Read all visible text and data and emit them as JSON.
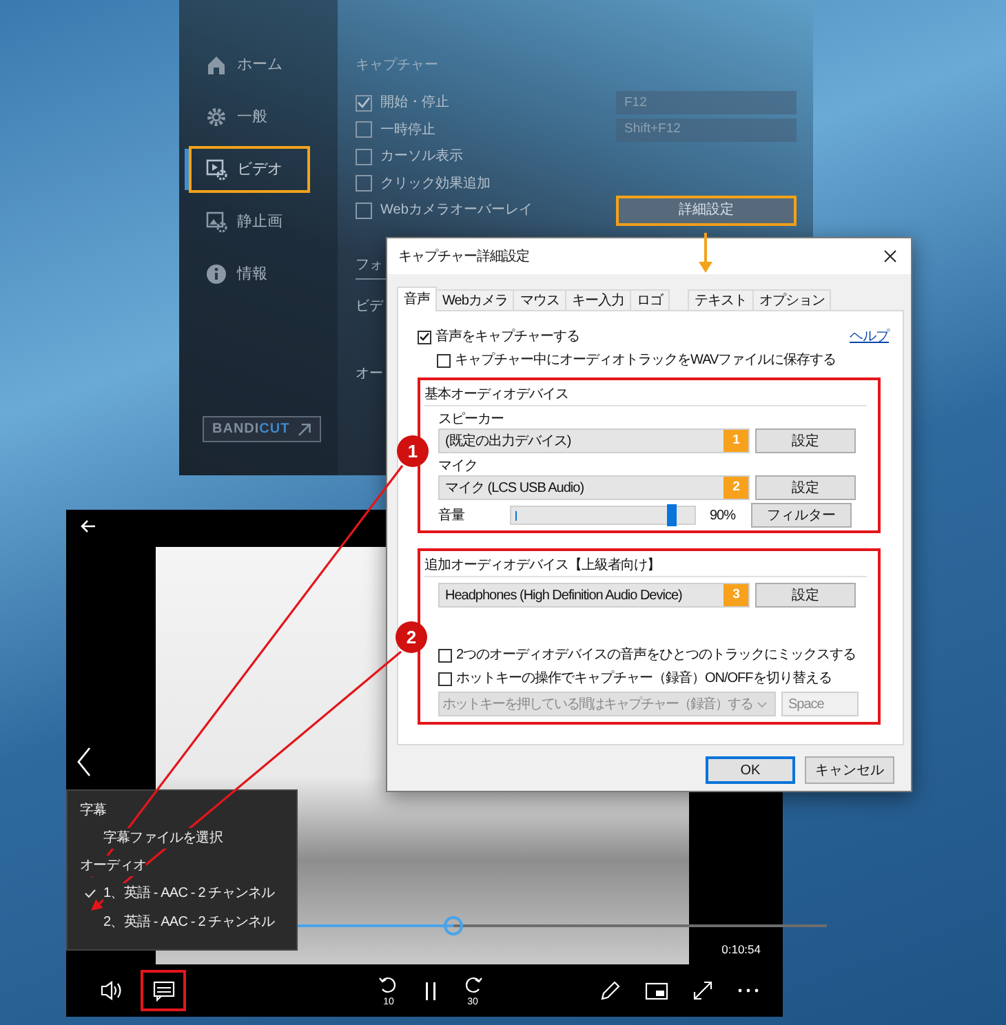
{
  "bandicam_window": {
    "sidebar": [
      {
        "label": "ホーム",
        "selected": false
      },
      {
        "label": "一般",
        "selected": false
      },
      {
        "label": "ビデオ",
        "selected": true
      },
      {
        "label": "静止画",
        "selected": false
      },
      {
        "label": "情報",
        "selected": false
      }
    ],
    "bandicut_button": {
      "parts": [
        "BANDI",
        "CUT"
      ]
    },
    "section_title": "キャプチャー",
    "options": [
      {
        "label": "開始・停止",
        "checked": true,
        "hotkey": "F12"
      },
      {
        "label": "一時停止",
        "checked": false,
        "hotkey": "Shift+F12"
      },
      {
        "label": "カーソル表示",
        "checked": false
      },
      {
        "label": "クリック効果追加",
        "checked": false
      },
      {
        "label": "Webカメラオーバーレイ",
        "checked": false
      }
    ],
    "advanced_button": "詳細設定",
    "format_heading": "フォ",
    "cut_labels": [
      "ビデ",
      "オー"
    ]
  },
  "dialog": {
    "title": "キャプチャー詳細設定",
    "tabs": [
      {
        "label": "音声",
        "selected": true
      },
      {
        "label": "Webカメラ",
        "selected": false
      },
      {
        "label": "マウス",
        "selected": false
      },
      {
        "label": "キー入力",
        "selected": false
      },
      {
        "label": "ロゴ",
        "selected": false
      },
      {
        "label": "テキスト",
        "selected": false
      },
      {
        "label": "オプション",
        "selected": false
      }
    ],
    "capture_audio": {
      "label": "音声をキャプチャーする",
      "checked": true
    },
    "help_link": "ヘルプ",
    "save_wav": {
      "label": "キャプチャー中にオーディオトラックをWAVファイルに保存する",
      "checked": false
    },
    "basic_group": {
      "title": "基本オーディオデバイス",
      "devices": [
        {
          "label": "スピーカー",
          "value": "(既定の出力デバイス)",
          "badge": "1",
          "button": "設定"
        },
        {
          "label": "マイク",
          "value": "マイク (LCS USB Audio)",
          "badge": "2",
          "button": "設定"
        }
      ],
      "volume": {
        "label": "音量",
        "level": 0.9,
        "reading": "90%",
        "button": "フィルター"
      }
    },
    "extra_group": {
      "title": "追加オーディオデバイス【上級者向け】",
      "device": {
        "value": "Headphones (High Definition Audio Device)",
        "badge": "3",
        "button": "設定"
      },
      "options": [
        {
          "label": "2つのオーディオデバイスの音声をひとつのトラックにミックスする",
          "checked": false
        },
        {
          "label": "ホットキーの操作でキャプチャー（録音）ON/OFFを切り替える",
          "checked": false
        }
      ],
      "hotkey_mode": {
        "value": "ホットキーを押している間はキャプチャー（録音）する",
        "disabled": true
      },
      "hotkey_key": {
        "value": "Space",
        "disabled": true
      }
    },
    "buttons": [
      {
        "label": "OK",
        "default": true
      },
      {
        "label": "キャンセル",
        "default": false
      }
    ]
  },
  "annotations": [
    {
      "number": "1"
    },
    {
      "number": "2"
    }
  ],
  "player": {
    "menu": {
      "sections": [
        {
          "title": "字幕",
          "items": [
            {
              "label": "字幕ファイルを選択",
              "selected": false
            }
          ]
        },
        {
          "title": "オーディオ",
          "items": [
            {
              "label": "1、英語 - AAC - 2 チャンネル",
              "selected": true
            },
            {
              "label": "2、英語 - AAC - 2 チャンネル",
              "selected": false
            }
          ]
        }
      ]
    },
    "progress": {
      "level": 0.45
    },
    "time": "0:10:54",
    "skip_back": "10",
    "skip_forward": "30"
  }
}
